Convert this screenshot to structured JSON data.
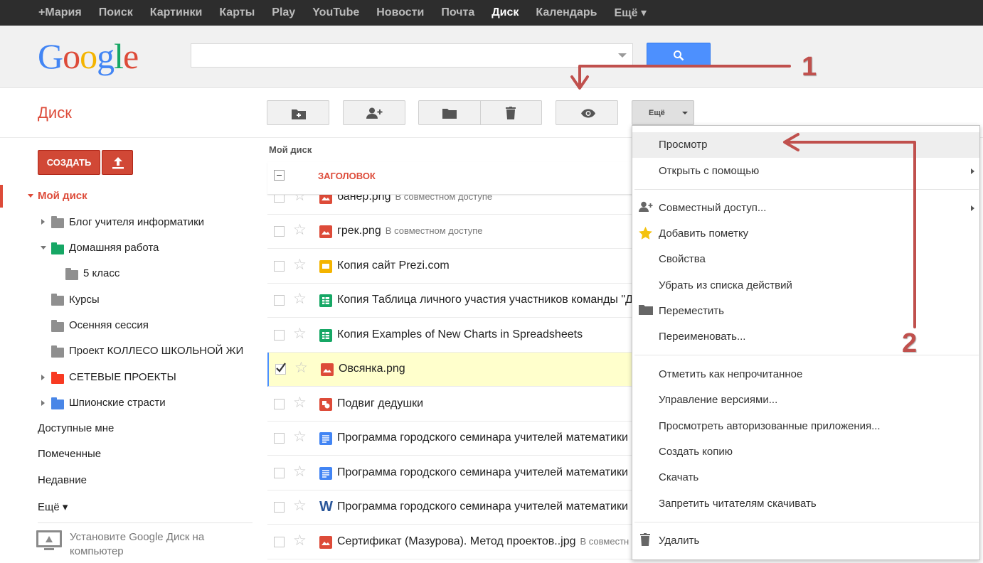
{
  "topbar": {
    "links": [
      "+Мария",
      "Поиск",
      "Картинки",
      "Карты",
      "Play",
      "YouTube",
      "Новости",
      "Почта",
      "Диск",
      "Календарь",
      "Ещё ▾"
    ],
    "active_index": 8
  },
  "header": {
    "logo": "Google",
    "search_value": ""
  },
  "app": {
    "title": "Диск"
  },
  "sidebar": {
    "create_label": "СОЗДАТЬ",
    "my_drive": "Мой диск",
    "folders": [
      {
        "label": "Блог учителя информатики",
        "color": "#8f8f8f"
      },
      {
        "label": "Домашняя работа",
        "color": "#16a765"
      },
      {
        "label": "5 класс",
        "color": "#8f8f8f"
      },
      {
        "label": "Курсы",
        "color": "#8f8f8f"
      },
      {
        "label": "Осенняя сессия",
        "color": "#8f8f8f"
      },
      {
        "label": "Проект КОЛЛЕСО ШКОЛЬНОЙ ЖИ",
        "color": "#8f8f8f"
      },
      {
        "label": "СЕТЕВЫЕ ПРОЕКТЫ",
        "color": "#f83a22"
      },
      {
        "label": "Шпионские страсти",
        "color": "#4986e7"
      }
    ],
    "links": [
      "Доступные мне",
      "Помеченные",
      "Недавние",
      "Ещё ▾"
    ],
    "install_text": "Установите Google Диск на компьютер"
  },
  "toolbar": {
    "more_label": "Ещё"
  },
  "filelist": {
    "breadcrumb": "Мой диск",
    "header_title": "ЗАГОЛОВОК",
    "rows": [
      {
        "name": "банер.png",
        "shared": "В совместном доступе",
        "icon": "image-icon",
        "color": "#dd4b39"
      },
      {
        "name": "грек.png",
        "shared": "В совместном доступе",
        "icon": "image-icon",
        "color": "#dd4b39"
      },
      {
        "name": "Копия сайт Prezi.com",
        "shared": "",
        "icon": "presentation-icon",
        "color": "#f4b400"
      },
      {
        "name": "Копия Таблица личного участия участников команды \"Де",
        "shared": "",
        "icon": "spreadsheet-icon",
        "color": "#16a765"
      },
      {
        "name": "Копия Examples of New Charts in Spreadsheets",
        "shared": "",
        "icon": "spreadsheet-icon",
        "color": "#16a765"
      },
      {
        "name": "Овсянка.png",
        "shared": "",
        "icon": "image-icon",
        "color": "#dd4b39"
      },
      {
        "name": "Подвиг дедушки",
        "shared": "",
        "icon": "drawing-icon",
        "color": "#dd4b39"
      },
      {
        "name": "Программа городского семинара учителей математики и",
        "shared": "",
        "icon": "document-icon",
        "color": "#4285f4"
      },
      {
        "name": "Программа городского семинара учителей математики и",
        "shared": "",
        "icon": "document-icon",
        "color": "#4285f4"
      },
      {
        "name": "Программа городского семинара учителей математики и",
        "shared": "",
        "icon": "word-icon",
        "color": "#2a5699"
      },
      {
        "name": "Сертификат (Мазурова). Метод проектов..jpg",
        "shared": "В совместн",
        "icon": "image-icon",
        "color": "#dd4b39"
      }
    ]
  },
  "menu": {
    "items": [
      "Просмотр",
      "Открыть с помощью",
      "Совместный доступ...",
      "Добавить пометку",
      "Свойства",
      "Убрать из списка действий",
      "Переместить",
      "Переименовать...",
      "Отметить как непрочитанное",
      "Управление версиями...",
      "Просмотреть авторизованные приложения...",
      "Создать копию",
      "Скачать",
      "Запретить читателям скачивать",
      "Удалить"
    ]
  },
  "annotations": {
    "one": "1",
    "two": "2",
    "color": "#c0504d"
  }
}
